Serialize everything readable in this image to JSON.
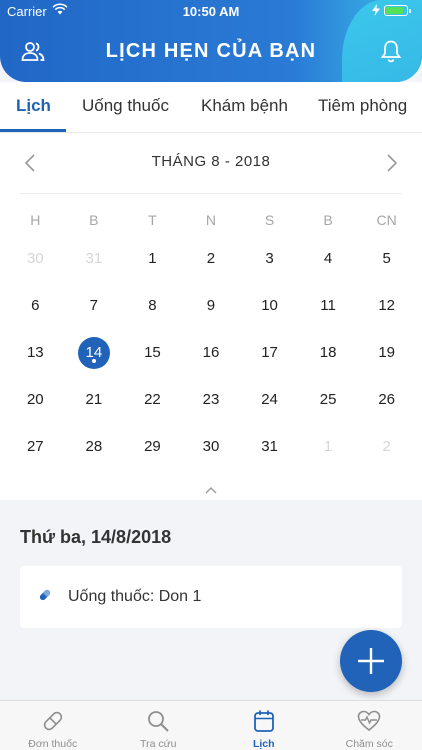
{
  "status_bar": {
    "carrier": "Carrier",
    "time": "10:50 AM",
    "battery_level": 0.9
  },
  "header": {
    "title": "LỊCH HẸN CỦA BẠN",
    "left_icon": "users-icon",
    "right_icon": "bell-icon"
  },
  "tabs": [
    {
      "label": "Lịch",
      "active": true
    },
    {
      "label": "Uống thuốc",
      "active": false
    },
    {
      "label": "Khám bệnh",
      "active": false
    },
    {
      "label": "Tiêm phòng",
      "active": false
    }
  ],
  "calendar": {
    "month_label": "THÁNG 8 - 2018",
    "weekdays": [
      "H",
      "B",
      "T",
      "N",
      "S",
      "B",
      "CN"
    ],
    "weeks": [
      [
        {
          "d": "30",
          "muted": true
        },
        {
          "d": "31",
          "muted": true
        },
        {
          "d": "1"
        },
        {
          "d": "2"
        },
        {
          "d": "3"
        },
        {
          "d": "4"
        },
        {
          "d": "5"
        }
      ],
      [
        {
          "d": "6"
        },
        {
          "d": "7"
        },
        {
          "d": "8"
        },
        {
          "d": "9"
        },
        {
          "d": "10"
        },
        {
          "d": "11"
        },
        {
          "d": "12"
        }
      ],
      [
        {
          "d": "13"
        },
        {
          "d": "14",
          "selected": true,
          "has_event": true
        },
        {
          "d": "15"
        },
        {
          "d": "16"
        },
        {
          "d": "17"
        },
        {
          "d": "18"
        },
        {
          "d": "19"
        }
      ],
      [
        {
          "d": "20"
        },
        {
          "d": "21"
        },
        {
          "d": "22"
        },
        {
          "d": "23"
        },
        {
          "d": "24"
        },
        {
          "d": "25"
        },
        {
          "d": "26"
        }
      ],
      [
        {
          "d": "27"
        },
        {
          "d": "28"
        },
        {
          "d": "29"
        },
        {
          "d": "30"
        },
        {
          "d": "31"
        },
        {
          "d": "1",
          "muted": true
        },
        {
          "d": "2",
          "muted": true
        }
      ]
    ]
  },
  "selected_date": {
    "heading": "Thứ ba, 14/8/2018",
    "events": [
      {
        "icon": "pill-icon",
        "text": "Uống thuốc: Don 1"
      }
    ]
  },
  "bottom_nav": [
    {
      "label": "Đơn thuốc",
      "icon": "pill-icon",
      "active": false
    },
    {
      "label": "Tra cứu",
      "icon": "search-icon",
      "active": false
    },
    {
      "label": "Lịch",
      "icon": "calendar-icon",
      "active": true
    },
    {
      "label": "Chăm sóc",
      "icon": "heart-pulse-icon",
      "active": false
    }
  ],
  "colors": {
    "primary": "#2163b8",
    "header_accent": "#3bc0e9",
    "inactive": "#8e8e8e"
  }
}
